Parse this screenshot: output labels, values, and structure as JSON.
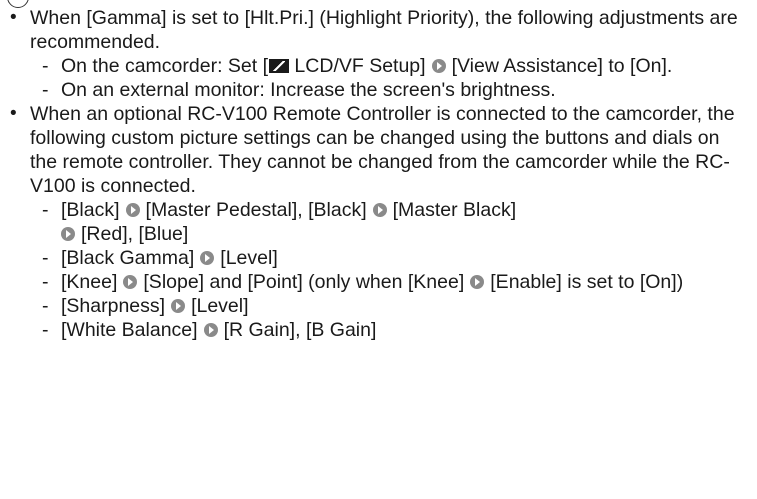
{
  "bullet1": {
    "text": "When [Gamma] is set to [Hlt.Pri.] (Highlight Priority), the following adjustments are recommended.",
    "sub1_a": "On the camcorder: Set [",
    "sub1_b": " LCD/VF Setup]",
    "sub1_c": "[View Assistance] to [On].",
    "sub2": "On an external monitor: Increase the screen's brightness."
  },
  "bullet2": {
    "text": "When an optional RC-V100 Remote Controller is connected to the camcorder, the following custom picture settings can be changed using the buttons and dials on the remote controller. They cannot be changed from the camcorder while the RC-V100 is connected.",
    "items": {
      "i1_a": "[Black]",
      "i1_b": "[Master Pedestal], [Black]",
      "i1_c": "[Master Black]",
      "i1_d": "[Red], [Blue]",
      "i2_a": "[Black Gamma]",
      "i2_b": "[Level]",
      "i3_a": "[Knee]",
      "i3_b": "[Slope] and [Point] (only when [Knee]",
      "i3_c": "[Enable] is set to [On])",
      "i4_a": "[Sharpness]",
      "i4_b": "[Level]",
      "i5_a": "[White Balance]",
      "i5_b": "[R Gain], [B Gain]"
    }
  },
  "glyphs": {
    "bullet": "•",
    "dash": "-"
  },
  "icons": {
    "step_arrow": "arrow-circle-icon",
    "lcd": "lcd-vf-icon"
  }
}
